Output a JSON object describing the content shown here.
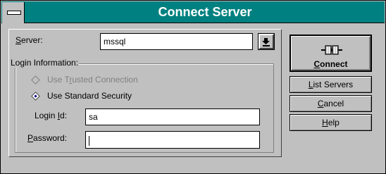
{
  "window": {
    "title": "Connect Server"
  },
  "server": {
    "label_before": "",
    "label_accel": "S",
    "label_after": "erver:",
    "value": "mssql"
  },
  "login_info": {
    "title": "Login Information:",
    "trusted": {
      "before": "Use T",
      "accel": "r",
      "after": "usted Connection",
      "checked": false,
      "enabled": false
    },
    "standard": {
      "before": "Use Standard Security",
      "checked": true,
      "enabled": true
    },
    "login_id": {
      "before": "Login ",
      "accel": "I",
      "after": "d:",
      "value": "sa"
    },
    "password": {
      "accel": "P",
      "after": "assword:",
      "value": ""
    }
  },
  "buttons": {
    "connect": {
      "accel": "C",
      "after": "onnect"
    },
    "list_servers": {
      "accel": "L",
      "after": "ist Servers"
    },
    "cancel": {
      "accel": "C",
      "after": "ancel"
    },
    "help": {
      "accel": "H",
      "after": "elp"
    }
  },
  "icons": {
    "sysmenu": "system-menu-icon",
    "dropdown": "down-arrow-icon",
    "connect": "plug-connector-icon"
  },
  "colors": {
    "titlebar": "#008080",
    "face": "#c0c0c0",
    "radio_dot": "#00008b"
  }
}
